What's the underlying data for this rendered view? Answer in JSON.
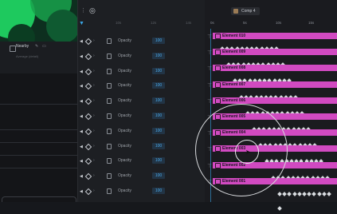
{
  "layer": {
    "name": "Nearby",
    "sub": "Average (detail)"
  },
  "composition": {
    "tab_label": "Comp 4"
  },
  "prop_ruler": [
    "10s",
    "12s",
    "14s"
  ],
  "timeline_ruler": [
    "0s",
    "5s",
    "10s",
    "15s"
  ],
  "properties": [
    {
      "label": "Opacity",
      "value": "100"
    },
    {
      "label": "Opacity",
      "value": "100"
    },
    {
      "label": "Opacity",
      "value": "100"
    },
    {
      "label": "Opacity",
      "value": "100"
    },
    {
      "label": "Opacity",
      "value": "100"
    },
    {
      "label": "Opacity",
      "value": "100"
    },
    {
      "label": "Opacity",
      "value": "100"
    },
    {
      "label": "Opacity",
      "value": "100"
    },
    {
      "label": "Opacity",
      "value": "100"
    },
    {
      "label": "Opacity",
      "value": "100"
    },
    {
      "label": "Opacity",
      "value": "100"
    }
  ],
  "tracks": [
    {
      "name": "Element 010"
    },
    {
      "name": "Element 009"
    },
    {
      "name": "Element 008"
    },
    {
      "name": "Element 007"
    },
    {
      "name": "Element 006"
    },
    {
      "name": "Element 005"
    },
    {
      "name": "Element 004"
    },
    {
      "name": "Element 003"
    },
    {
      "name": "Element 002"
    },
    {
      "name": "Element 001"
    }
  ],
  "colors": {
    "track_bar": "#d14ac1",
    "accent": "#3aa6e6",
    "value": "#49a8e8"
  }
}
